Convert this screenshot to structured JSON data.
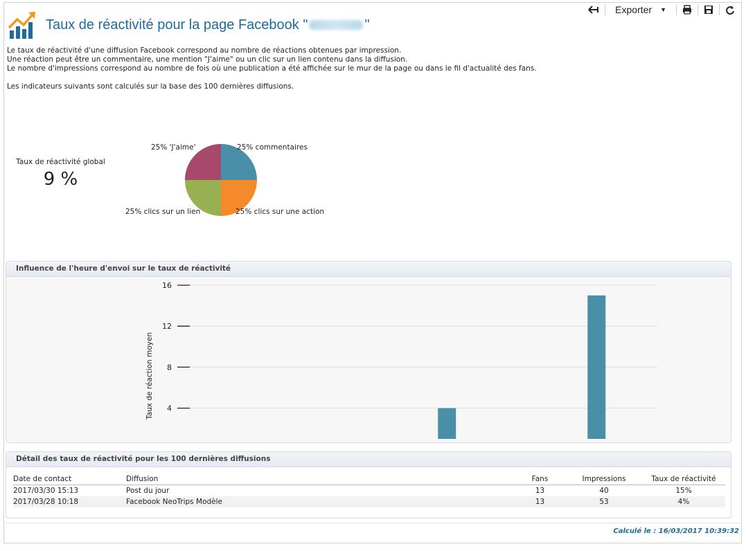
{
  "toolbar": {
    "back_icon": "back-arrow-icon",
    "export_label": "Exporter",
    "print_icon": "printer-icon",
    "save_icon": "floppy-disk-icon",
    "refresh_icon": "refresh-icon"
  },
  "header": {
    "title_prefix": "Taux de réactivité pour la page Facebook \"",
    "title_suffix": "\"",
    "logo_icon": "chart-trend-icon"
  },
  "description": {
    "line1": "Le taux de réactivité d'une diffusion Facebook correspond au nombre de réactions obtenues par impression.",
    "line2": "Une réaction peut être un commentaire, une mention \"J'aime\" ou un clic sur un lien contenu dans la diffusion.",
    "line3": "Le nombre d'impressions correspond au nombre de fois où une publication a été affichée sur le mur de la page ou dans le fil d'actualité des fans.",
    "line4": "Les indicateurs suivants sont calculés sur la base des 100 dernières diffusions."
  },
  "global_rate": {
    "label": "Taux de réactivité global",
    "value": "9 %"
  },
  "pie": {
    "chart_data": {
      "type": "pie",
      "slices": [
        {
          "label": "25% commentaires",
          "value": 25,
          "color": "#4a8fa8"
        },
        {
          "label": "25% clics sur une action",
          "value": 25,
          "color": "#f58a2a"
        },
        {
          "label": "25% clics sur un lien",
          "value": 25,
          "color": "#97b152"
        },
        {
          "label": "25% 'J'aime'",
          "value": 25,
          "color": "#a8486a"
        }
      ]
    }
  },
  "bar_panel": {
    "title": "Influence de l'heure d'envoi sur le taux de réactivité",
    "chart_data": {
      "type": "bar",
      "ylabel": "Taux de réaction moyen",
      "yticks": [
        4,
        8,
        12,
        16
      ],
      "ylim": [
        1,
        16
      ],
      "bars": [
        {
          "x_fraction": 0.55,
          "value": 4
        },
        {
          "x_fraction": 0.87,
          "value": 15
        }
      ],
      "color": "#4a8fa8"
    }
  },
  "table_panel": {
    "title": "Détail des taux de réactivité pour les 100 dernières diffusions",
    "columns": [
      "Date de contact",
      "Diffusion",
      "Fans",
      "Impressions",
      "Taux de réactivité"
    ],
    "rows": [
      [
        "2017/03/30 15:13",
        "Post du jour",
        "13",
        "40",
        "15%"
      ],
      [
        "2017/03/28 10:18",
        "Facebook NeoTrips Modèle",
        "13",
        "53",
        "4%"
      ]
    ]
  },
  "footer": {
    "computed": "Calculé le : 16/03/2017 10:39:32"
  }
}
